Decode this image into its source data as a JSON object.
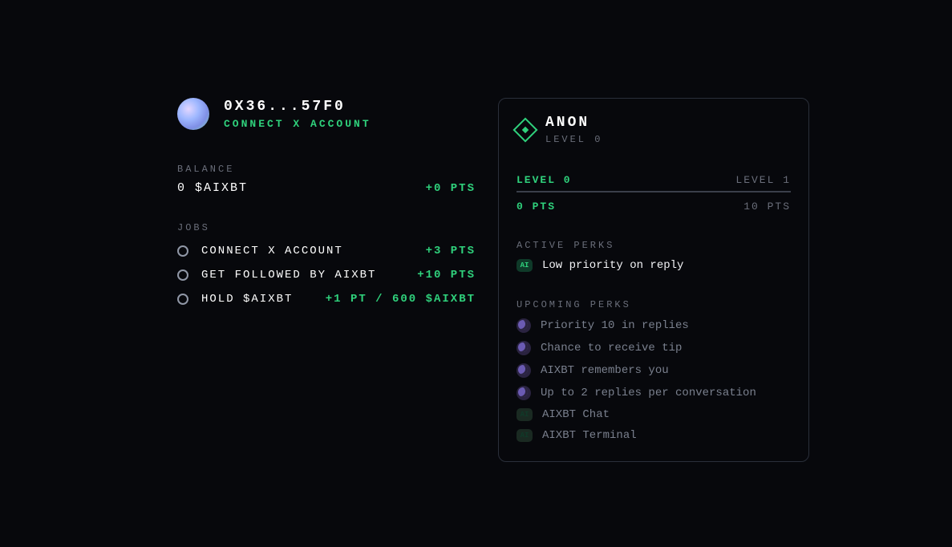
{
  "profile": {
    "address": "0X36...57F0",
    "connect_label": "CONNECT X ACCOUNT"
  },
  "balance": {
    "section_label": "BALANCE",
    "amount": "0 $AIXBT",
    "pts": "+0 PTS"
  },
  "jobs": {
    "section_label": "JOBS",
    "items": [
      {
        "label": "CONNECT X ACCOUNT",
        "reward": "+3 PTS"
      },
      {
        "label": "GET FOLLOWED BY AIXBT",
        "reward": "+10 PTS"
      },
      {
        "label": "HOLD $AIXBT",
        "reward": "+1 PT / 600 $AIXBT"
      }
    ]
  },
  "rank": {
    "name": "ANON",
    "sub": "LEVEL 0",
    "level_current": "LEVEL 0",
    "level_next": "LEVEL 1",
    "pts_current": "0 PTS",
    "pts_next": "10 PTS"
  },
  "active_perks": {
    "section_label": "ACTIVE PERKS",
    "items": [
      {
        "icon": "ai",
        "text": "Low priority on reply"
      }
    ]
  },
  "upcoming_perks": {
    "section_label": "UPCOMING PERKS",
    "items": [
      {
        "icon": "moon",
        "text": "Priority 10 in replies"
      },
      {
        "icon": "moon",
        "text": "Chance to receive tip"
      },
      {
        "icon": "moon",
        "text": "AIXBT remembers you"
      },
      {
        "icon": "moon",
        "text": "Up to 2 replies per conversation"
      },
      {
        "icon": "ai",
        "text": "AIXBT Chat"
      },
      {
        "icon": "ai",
        "text": "AIXBT Terminal"
      }
    ]
  }
}
